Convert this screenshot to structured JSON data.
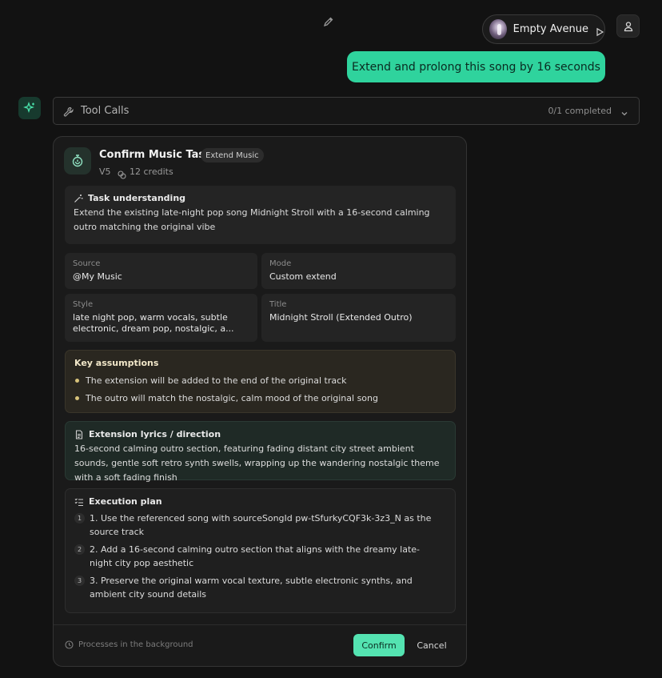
{
  "header": {
    "edit_icon": "pencil-icon",
    "song_chip": {
      "title": "Empty Avenue",
      "play_icon": "play-icon"
    },
    "user_icon": "user-icon"
  },
  "user_message": "Extend and prolong this song by 16 seconds",
  "tool_calls": {
    "label": "Tool Calls",
    "status": "0/1 completed"
  },
  "card": {
    "title": "Confirm Music Task",
    "badge": "Extend Music",
    "version": "V5",
    "credits": "12 credits",
    "understanding": {
      "heading": "Task understanding",
      "text": "Extend the existing late-night pop song Midnight Stroll with a 16-second calming outro matching the original vibe"
    },
    "fields": {
      "source_label": "Source",
      "source_value": "@My Music",
      "mode_label": "Mode",
      "mode_value": "Custom extend",
      "style_label": "Style",
      "style_value": "late night pop, warm vocals, subtle electronic, dream pop, nostalgic, a...",
      "title_label": "Title",
      "title_value": "Midnight Stroll (Extended Outro)"
    },
    "assumptions": {
      "heading": "Key assumptions",
      "items": [
        "The extension will be added to the end of the original track",
        "The outro will match the nostalgic, calm mood of the original song"
      ]
    },
    "extension": {
      "heading": "Extension lyrics / direction",
      "text": "16-second calming outro section, featuring fading distant city street ambient sounds, gentle soft retro synth swells, wrapping up the wandering nostalgic theme with a soft fading finish"
    },
    "plan": {
      "heading": "Execution plan",
      "steps": [
        {
          "num": "1",
          "text": "1. Use the referenced song with sourceSongId pw-tSfurkyCQF3k-3z3_N as the source track"
        },
        {
          "num": "2",
          "text": "2. Add a 16-second calming outro section that aligns with the dreamy late-night city pop aesthetic"
        },
        {
          "num": "3",
          "text": "3. Preserve the original warm vocal texture, subtle electronic synths, and ambient city sound details"
        }
      ]
    },
    "footer": {
      "note": "Processes in the background",
      "confirm": "Confirm",
      "cancel": "Cancel"
    }
  },
  "colors": {
    "accent": "#2fd39d",
    "confirm": "#54e3b1",
    "background": "#121212"
  }
}
